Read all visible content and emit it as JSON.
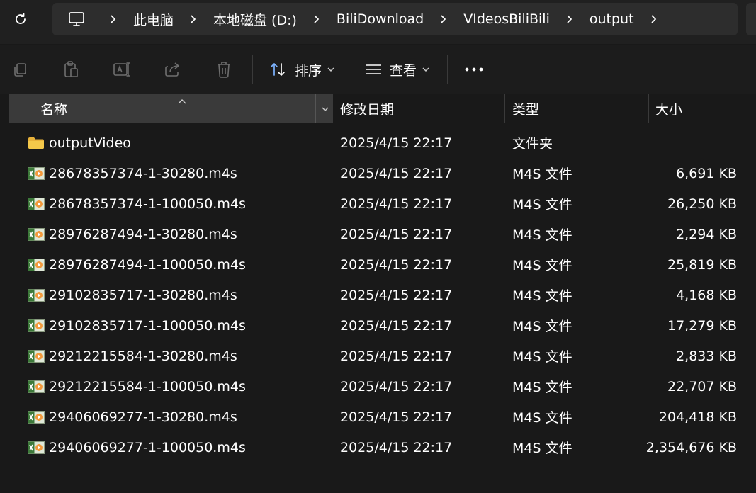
{
  "address_bar": {
    "breadcrumbs": [
      "此电脑",
      "本地磁盘 (D:)",
      "BiliDownload",
      "VIdeosBiliBili",
      "output"
    ]
  },
  "command_bar": {
    "sort_label": "排序",
    "view_label": "查看"
  },
  "columns": {
    "name": "名称",
    "date": "修改日期",
    "type": "类型",
    "size": "大小"
  },
  "files": [
    {
      "name": "outputVideo",
      "date": "2025/4/15 22:17",
      "type": "文件夹",
      "size": "",
      "icon": "folder-icon"
    },
    {
      "name": "28678357374-1-30280.m4s",
      "date": "2025/4/15 22:17",
      "type": "M4S 文件",
      "size": "6,691 KB",
      "icon": "m4s-file-icon"
    },
    {
      "name": "28678357374-1-100050.m4s",
      "date": "2025/4/15 22:17",
      "type": "M4S 文件",
      "size": "26,250 KB",
      "icon": "m4s-file-icon"
    },
    {
      "name": "28976287494-1-30280.m4s",
      "date": "2025/4/15 22:17",
      "type": "M4S 文件",
      "size": "2,294 KB",
      "icon": "m4s-file-icon"
    },
    {
      "name": "28976287494-1-100050.m4s",
      "date": "2025/4/15 22:17",
      "type": "M4S 文件",
      "size": "25,819 KB",
      "icon": "m4s-file-icon"
    },
    {
      "name": "29102835717-1-30280.m4s",
      "date": "2025/4/15 22:17",
      "type": "M4S 文件",
      "size": "4,168 KB",
      "icon": "m4s-file-icon"
    },
    {
      "name": "29102835717-1-100050.m4s",
      "date": "2025/4/15 22:17",
      "type": "M4S 文件",
      "size": "17,279 KB",
      "icon": "m4s-file-icon"
    },
    {
      "name": "29212215584-1-30280.m4s",
      "date": "2025/4/15 22:17",
      "type": "M4S 文件",
      "size": "2,833 KB",
      "icon": "m4s-file-icon"
    },
    {
      "name": "29212215584-1-100050.m4s",
      "date": "2025/4/15 22:17",
      "type": "M4S 文件",
      "size": "22,707 KB",
      "icon": "m4s-file-icon"
    },
    {
      "name": "29406069277-1-30280.m4s",
      "date": "2025/4/15 22:17",
      "type": "M4S 文件",
      "size": "204,418 KB",
      "icon": "m4s-file-icon"
    },
    {
      "name": "29406069277-1-100050.m4s",
      "date": "2025/4/15 22:17",
      "type": "M4S 文件",
      "size": "2,354,676 KB",
      "icon": "m4s-file-icon"
    }
  ],
  "colors": {
    "background": "#191919",
    "header_active": "#3a3a3a",
    "address_bg": "#2d2d2d",
    "folder": "#f4c84a",
    "disabled_icon": "#6e6e6e",
    "accent_blue": "#7db3ff"
  }
}
